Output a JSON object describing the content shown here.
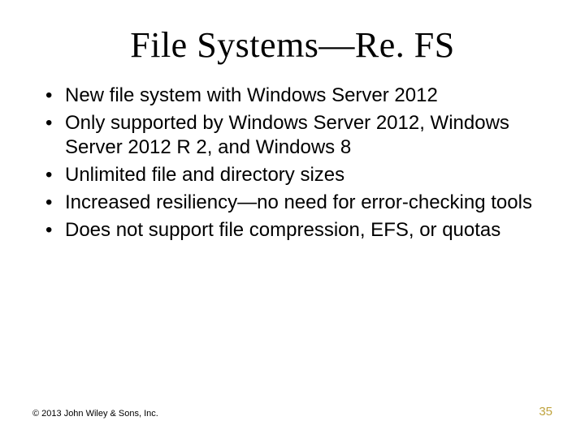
{
  "title": "File Systems—Re. FS",
  "bullets": [
    "New file system with Windows Server 2012",
    "Only supported by Windows Server 2012, Windows Server 2012 R 2, and Windows 8",
    "Unlimited file and directory sizes",
    "Increased resiliency—no need for error-checking tools",
    "Does not support file compression, EFS, or quotas"
  ],
  "footer": {
    "copyright": "© 2013 John Wiley & Sons, Inc.",
    "page": "35"
  }
}
